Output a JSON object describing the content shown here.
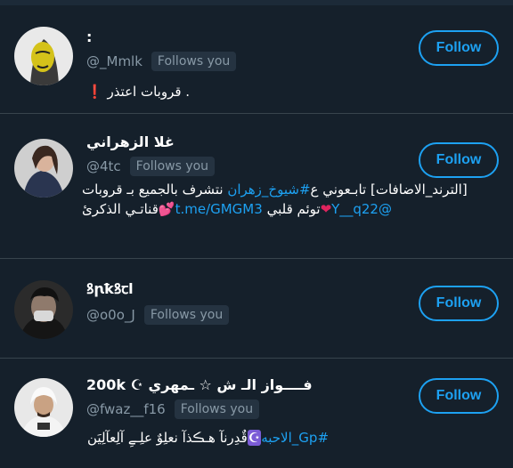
{
  "users": [
    {
      "name": ":",
      "handle": "@_Mmlk",
      "follows_you": "Follows you",
      "follow_label": "Follow",
      "bio": ". قروبات اعتذر ❗",
      "avatar": "yellow-portrait"
    },
    {
      "name": "غلا الزهراني",
      "handle": "@4tc",
      "follows_you": "Follows you",
      "follow_label": "Follow",
      "bio_line1_a": "[الترند_الاضافات] تابـعوني ع",
      "bio_line1_link": "#شيوخ_زهران",
      "bio_line1_b": "نتشرف بالجميع بـ قروبات",
      "bio_line2_handle": "@Y__q22",
      "bio_line2_a": "توئم قلبي",
      "bio_line2_link": "t.me/GMGM3",
      "bio_line2_b": "قناتـي الذكرئ",
      "avatar": "woman-photo"
    },
    {
      "name": "ꝸꞃꝁꝸꞇl",
      "handle": "@o0o_J",
      "follows_you": "Follows you",
      "follow_label": "Follow",
      "avatar": "masked-man"
    },
    {
      "name": "200k ☪ فــــواز الـ ش ☆ ـمهري",
      "handle": "@fwaz__f16",
      "follows_you": "Follows you",
      "follow_label": "Follow",
      "bio_link": "#Gp_الاحبه",
      "bio_text": "قٌدِرنآ هـڪذآ نعلِوٌ علِـےِ آلِعآلِيَن",
      "avatar": "man-shemagh"
    }
  ],
  "colors": {
    "background": "#15202b",
    "accent": "#1da1f2",
    "muted": "#8899a6",
    "divider": "#38444d"
  }
}
